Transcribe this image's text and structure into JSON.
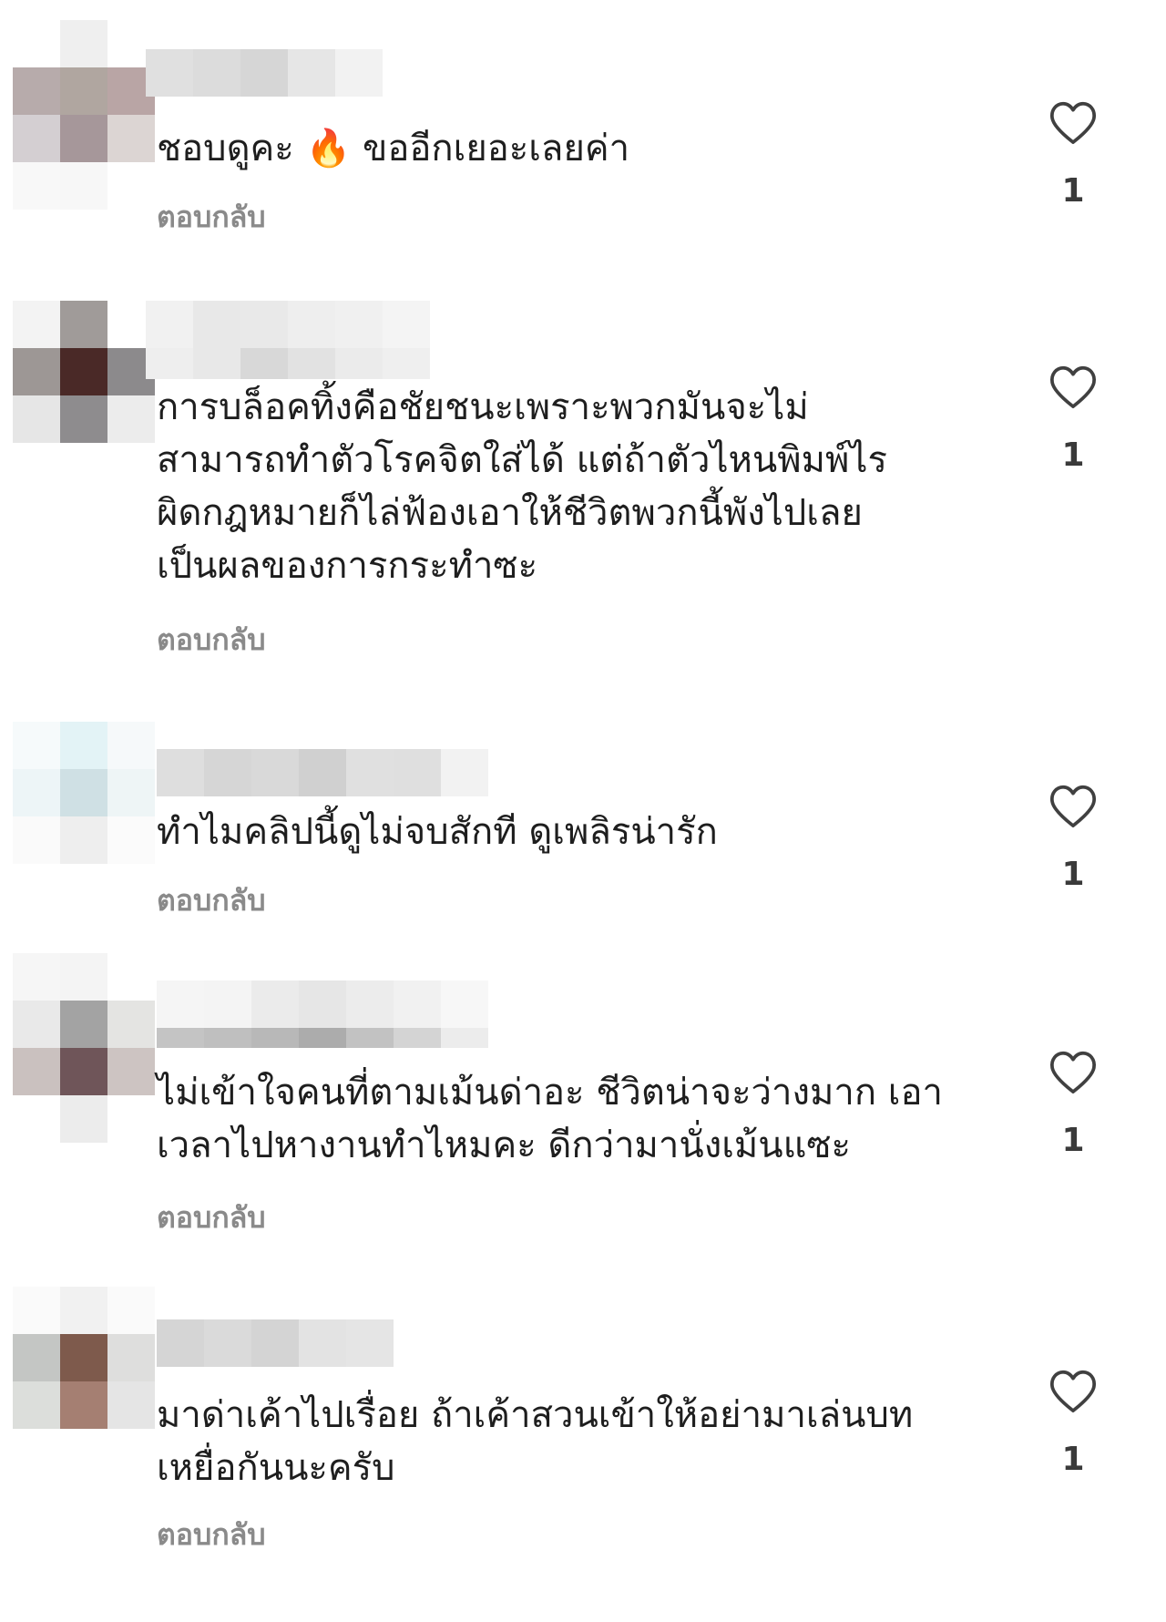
{
  "reply_label": "ตอบกลับ",
  "heart_icon": "heart-outline-icon",
  "colors": {
    "text": "#1e1e1e",
    "reply": "#8a8a8a",
    "count": "#3a3a3a"
  },
  "comments": [
    {
      "text_before_emoji": "ชอบดูคะ",
      "emoji": "🔥",
      "text_after_emoji": "ขออีกเยอะเลยค่า",
      "likes": "1"
    },
    {
      "text": "การบล็อคทิ้งคือชัยชนะเพราะพวกมันจะไม่\nสามารถทำตัวโรคจิตใส่ได้ แต่ถ้าตัวไหนพิมพ์ไร\nผิดกฎหมายก็ไล่ฟ้องเอาให้ชีวิตพวกนี้พังไปเลย\nเป็นผลของการกระทำซะ",
      "likes": "1"
    },
    {
      "text": "ทำไมคลิปนี้ดูไม่จบสักที ดูเพลิรน่ารัก",
      "likes": "1"
    },
    {
      "text": "ไม่เข้าใจคนที่ตามเม้นด่าอะ ชีวิตน่าจะว่างมาก เอา\nเวลาไปหางานทำไหมคะ ดีกว่ามานั่งเม้นแซะ",
      "likes": "1"
    },
    {
      "text": "มาด่าเค้าไปเรื่อย ถ้าเค้าสวนเข้าให้อย่ามาเล่นบท\nเหยื่อกันนะครับ",
      "likes": "1"
    }
  ]
}
